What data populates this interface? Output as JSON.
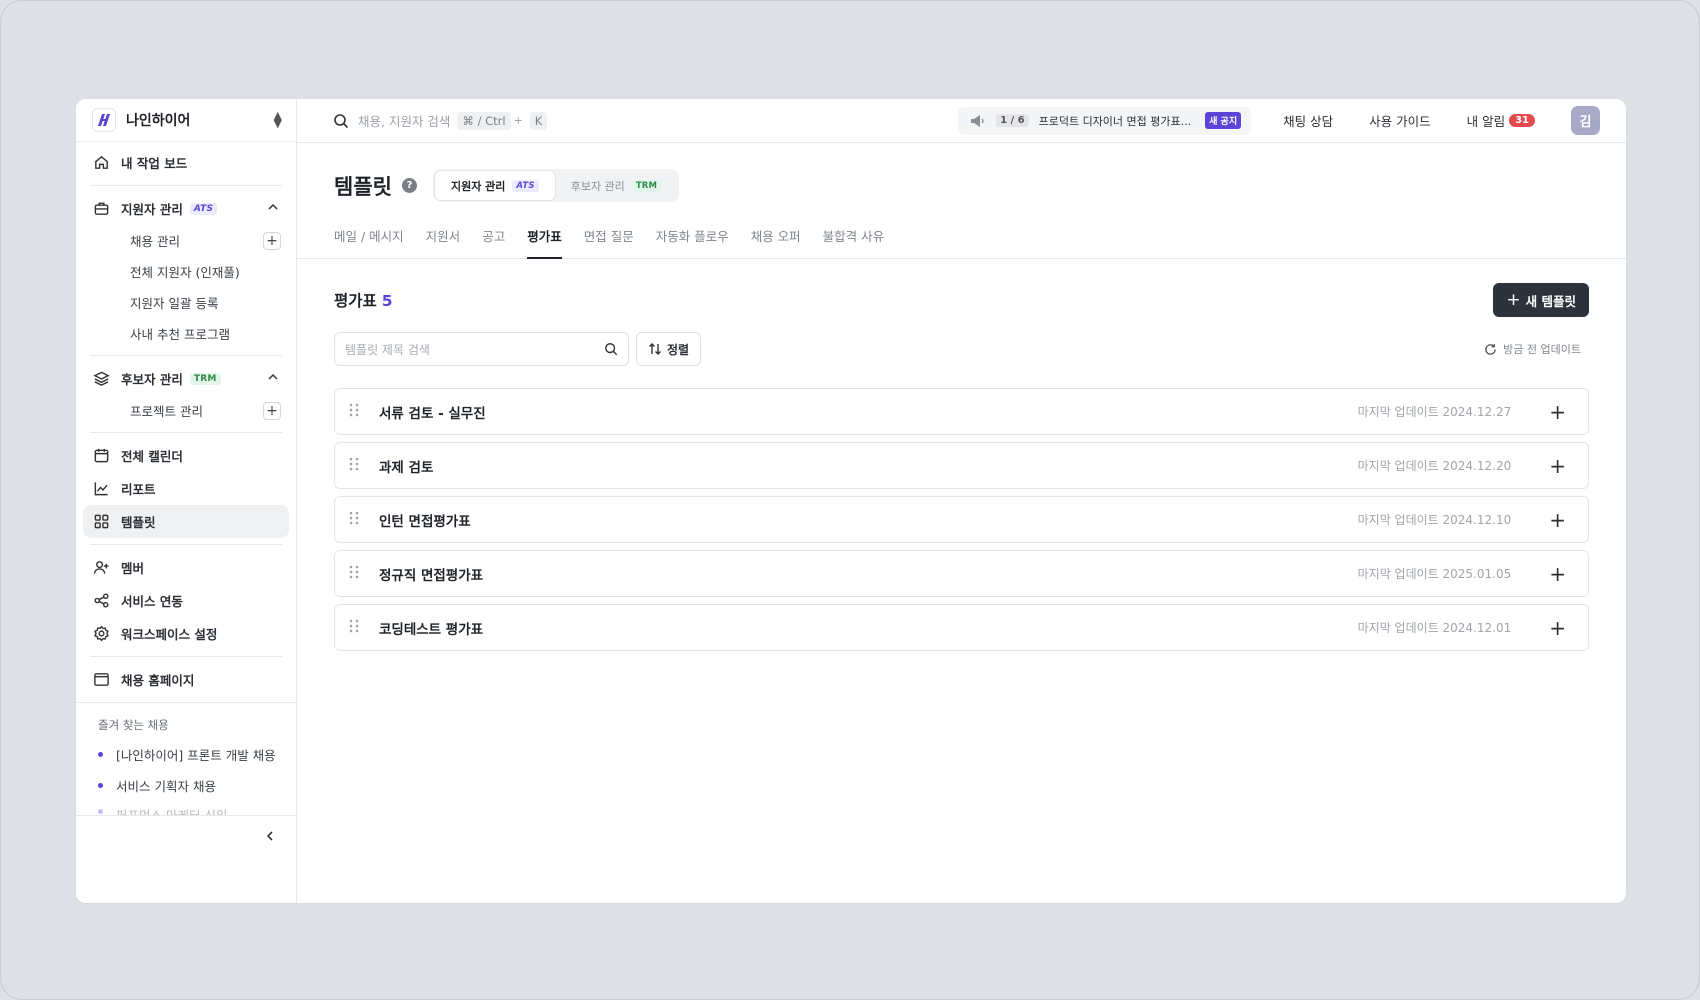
{
  "sidebar": {
    "workspace": "나인하이어",
    "home": "내 작업 보드",
    "applicant_mgmt": {
      "label": "지원자 관리",
      "badge": "ATS"
    },
    "applicant_sub": [
      "채용 관리",
      "전체 지원자 (인재풀)",
      "지원자 일괄 등록",
      "사내 추천 프로그램"
    ],
    "candidate_mgmt": {
      "label": "후보자 관리",
      "badge": "TRM"
    },
    "candidate_sub": [
      "프로젝트 관리"
    ],
    "calendar": "전체 캘린더",
    "report": "리포트",
    "templates": "템플릿",
    "members": "멤버",
    "integrations": "서비스 연동",
    "workspace_settings": "워크스페이스 설정",
    "career_site": "채용 홈페이지",
    "favorites_title": "즐겨 찾는 채용",
    "favorites": [
      "[나인하이어] 프론트 개발 채용",
      "서비스 기획자 채용",
      "퍼포먼스 마케터 신입"
    ]
  },
  "topbar": {
    "search_placeholder": "채용, 지원자 검색",
    "shortcut_mod": "⌘ / Ctrl",
    "shortcut_plus": "+",
    "shortcut_key": "K",
    "notice_count": "1 / 6",
    "notice_text": "프로덕트 디자이너 면접 평가표...",
    "notice_badge": "새 공지",
    "chat": "채팅 상담",
    "guide": "사용 가이드",
    "alerts": "내 알림",
    "alerts_count": "31",
    "avatar": "김"
  },
  "header": {
    "title": "템플릿",
    "help": "?",
    "seg_applicant": {
      "label": "지원자 관리",
      "badge": "ATS"
    },
    "seg_candidate": {
      "label": "후보자 관리",
      "badge": "TRM"
    },
    "tabs": [
      "메일 / 메시지",
      "지원서",
      "공고",
      "평가표",
      "면접 질문",
      "자동화 플로우",
      "채용 오퍼",
      "불합격 사유"
    ]
  },
  "content": {
    "section_title": "평가표",
    "section_count": "5",
    "new_button": "새 템플릿",
    "search_placeholder": "템플릿 제목 검색",
    "sort": "정렬",
    "refresh": "방금 전 업데이트",
    "rows": [
      {
        "title": "서류 검토 - 실무진",
        "updated": "마지막 업데이트 2024.12.27"
      },
      {
        "title": "과제 검토",
        "updated": "마지막 업데이트 2024.12.20"
      },
      {
        "title": "인턴 면접평가표",
        "updated": "마지막 업데이트 2024.12.10"
      },
      {
        "title": "정규직 면접평가표",
        "updated": "마지막 업데이트 2025.01.05"
      },
      {
        "title": "코딩테스트 평가표",
        "updated": "마지막 업데이트 2024.12.01"
      }
    ]
  },
  "colors": {
    "accent": "#5b45d8",
    "primary_button": "#2c333c",
    "alert": "#e5484d"
  }
}
